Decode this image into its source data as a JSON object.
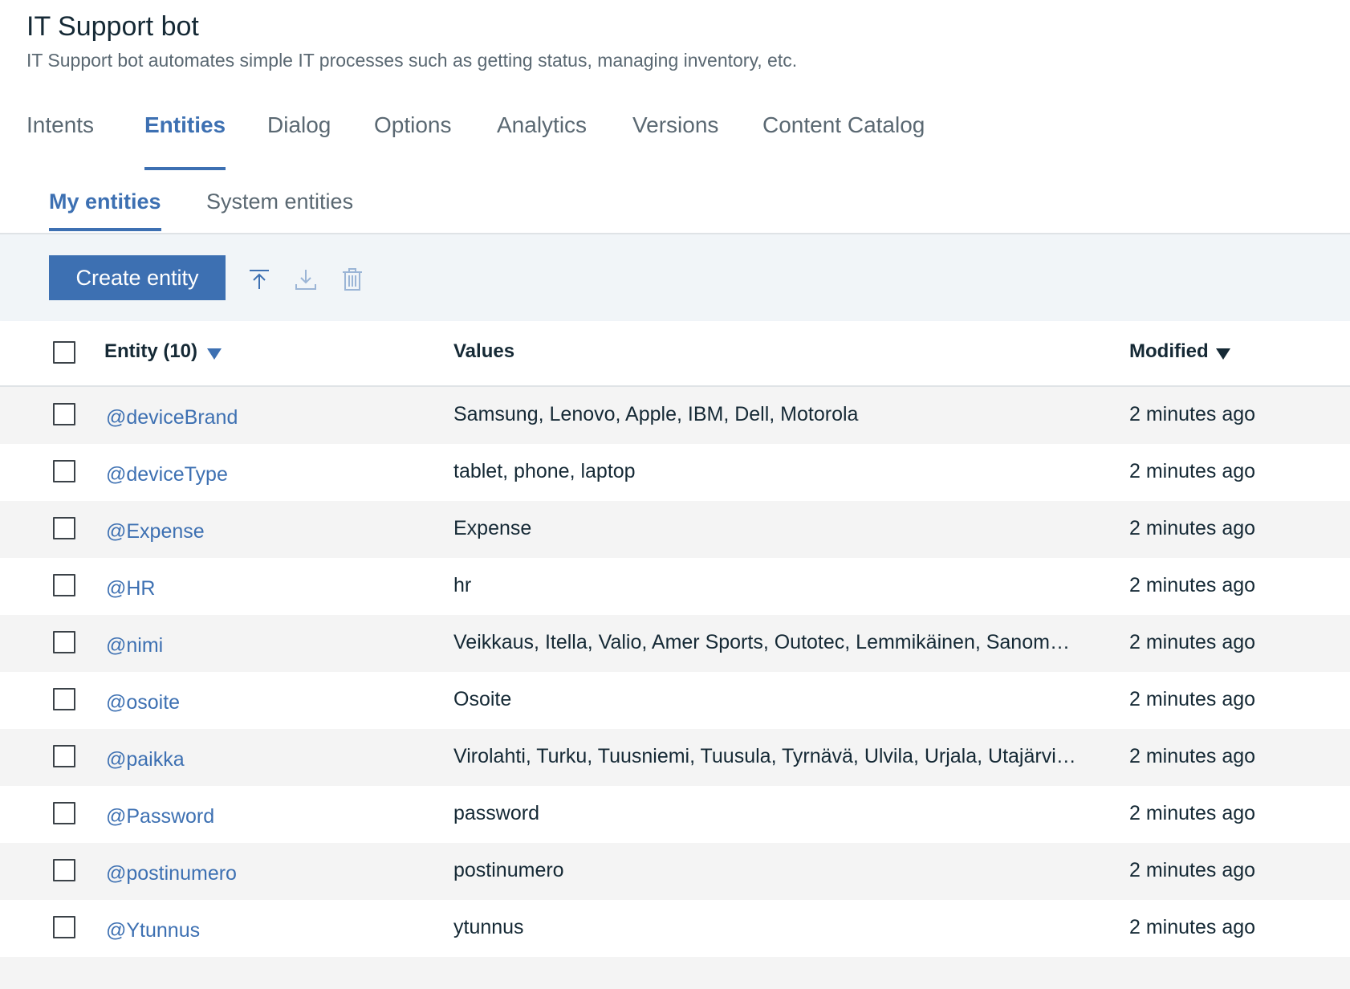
{
  "header": {
    "title": "IT Support bot",
    "subtitle": "IT Support bot automates simple IT processes such as getting status, managing inventory, etc."
  },
  "tabs": [
    {
      "label": "Intents",
      "active": false
    },
    {
      "label": "Entities",
      "active": true
    },
    {
      "label": "Dialog",
      "active": false
    },
    {
      "label": "Options",
      "active": false
    },
    {
      "label": "Analytics",
      "active": false
    },
    {
      "label": "Versions",
      "active": false
    },
    {
      "label": "Content Catalog",
      "active": false
    }
  ],
  "subtabs": [
    {
      "label": "My entities",
      "active": true
    },
    {
      "label": "System entities",
      "active": false
    }
  ],
  "toolbar": {
    "create_label": "Create entity",
    "icons": [
      "upload-icon",
      "download-icon",
      "trash-icon"
    ]
  },
  "table": {
    "headers": {
      "entity": "Entity (10)",
      "values": "Values",
      "modified": "Modified"
    },
    "rows": [
      {
        "entity": "@deviceBrand",
        "values": "Samsung, Lenovo, Apple, IBM, Dell, Motorola",
        "modified": "2 minutes ago"
      },
      {
        "entity": "@deviceType",
        "values": "tablet, phone, laptop",
        "modified": "2 minutes ago"
      },
      {
        "entity": "@Expense",
        "values": "Expense",
        "modified": "2 minutes ago"
      },
      {
        "entity": "@HR",
        "values": "hr",
        "modified": "2 minutes ago"
      },
      {
        "entity": "@nimi",
        "values": "Veikkaus, Itella, Valio, Amer Sports, Outotec, Lemmikäinen, Sanoma, P...",
        "modified": "2 minutes ago"
      },
      {
        "entity": "@osoite",
        "values": "Osoite",
        "modified": "2 minutes ago"
      },
      {
        "entity": "@paikka",
        "values": "Virolahti, Turku, Tuusniemi, Tuusula, Tyrnävä, Ulvila, Urjala, Utajärvi, Ut...",
        "modified": "2 minutes ago"
      },
      {
        "entity": "@Password",
        "values": "password",
        "modified": "2 minutes ago"
      },
      {
        "entity": "@postinumero",
        "values": "postinumero",
        "modified": "2 minutes ago"
      },
      {
        "entity": "@Ytunnus",
        "values": "ytunnus",
        "modified": "2 minutes ago"
      }
    ]
  },
  "colors": {
    "accent": "#3d70b2",
    "text": "#152935",
    "muted": "#5a6872"
  }
}
